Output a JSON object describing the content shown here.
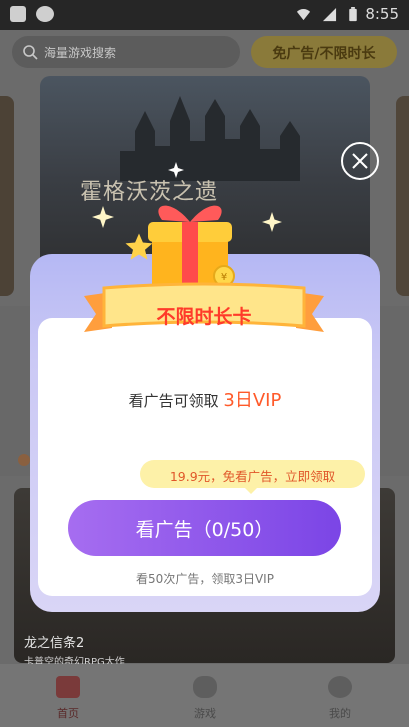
{
  "status_bar": {
    "time": "8:55"
  },
  "search": {
    "placeholder": "海量游戏搜索"
  },
  "header": {
    "no_ad_button": "免广告/不限时长"
  },
  "banner": {
    "title": "霍格沃茨之遗"
  },
  "game_card": {
    "title": "龙之信条2",
    "subtitle": "卡普空的奇幻RPG大作"
  },
  "bottom_nav": [
    {
      "label": "首页",
      "icon": "home-icon",
      "active": true
    },
    {
      "label": "游戏",
      "icon": "gamepad-icon",
      "active": false
    },
    {
      "label": "我的",
      "icon": "profile-icon",
      "active": false
    }
  ],
  "modal": {
    "ribbon_title": "不限时长卡",
    "reward_prefix": "看广告可领取 ",
    "reward_highlight": "3日VIP",
    "promo": "19.9元，免看广告，立即领取",
    "watch_button": "看广告（0/50）",
    "hint": "看50次广告，领取3日VIP"
  },
  "colors": {
    "accent_purple": "#7b45e6",
    "ribbon_red": "#ff3b2a",
    "promo_bg": "#fdf1a8",
    "promo_text": "#e0572a"
  }
}
